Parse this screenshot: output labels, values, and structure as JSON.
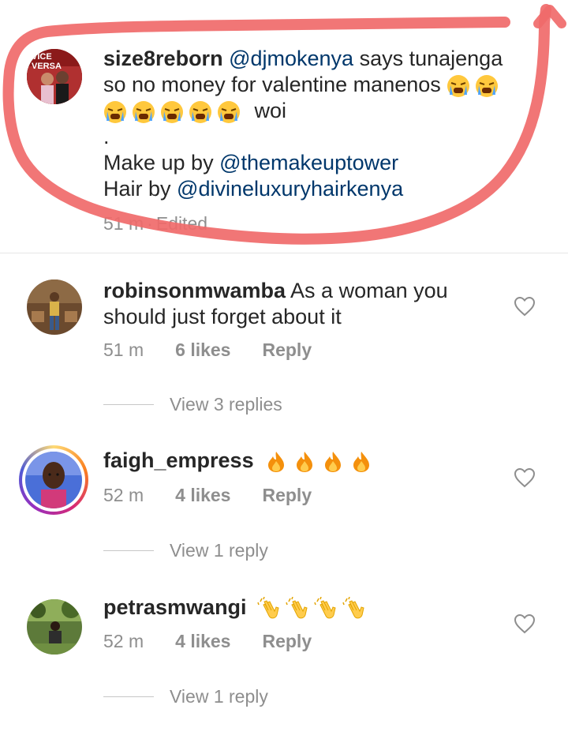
{
  "caption": {
    "username": "size8reborn",
    "mention": "@djmokenya",
    "text_1": "says tunajenga",
    "text_2": "so no money for valentine manenos",
    "text_3": "woi",
    "dot": ".",
    "makeup_prefix": "Make up by",
    "makeup_mention": "@themakeuptower",
    "hair_prefix": "Hair by",
    "hair_mention": "@divineluxuryhairkenya",
    "time": "51 m",
    "edited": "Edited",
    "avatar_text": "VICE VERSA",
    "emoji": "crying-face-emoji"
  },
  "comments": [
    {
      "username": "robinsonmwamba",
      "text_1": "As a woman you",
      "text_2": "should just forget about it",
      "time": "51 m",
      "likes": "6 likes",
      "reply": "Reply",
      "view_replies": "View 3 replies"
    },
    {
      "username": "faigh_empress",
      "emoji": "fire-emoji",
      "time": "52 m",
      "likes": "4 likes",
      "reply": "Reply",
      "view_replies": "View 1 reply"
    },
    {
      "username": "petrasmwangi",
      "emoji": "clapping-hands-emoji",
      "time": "52 m",
      "likes": "4 likes",
      "reply": "Reply",
      "view_replies": "View 1 reply"
    }
  ],
  "colors": {
    "annotation": "#f06a6a",
    "mention": "#00376b",
    "meta": "#8e8e8e",
    "story_ring": "#d62976"
  }
}
